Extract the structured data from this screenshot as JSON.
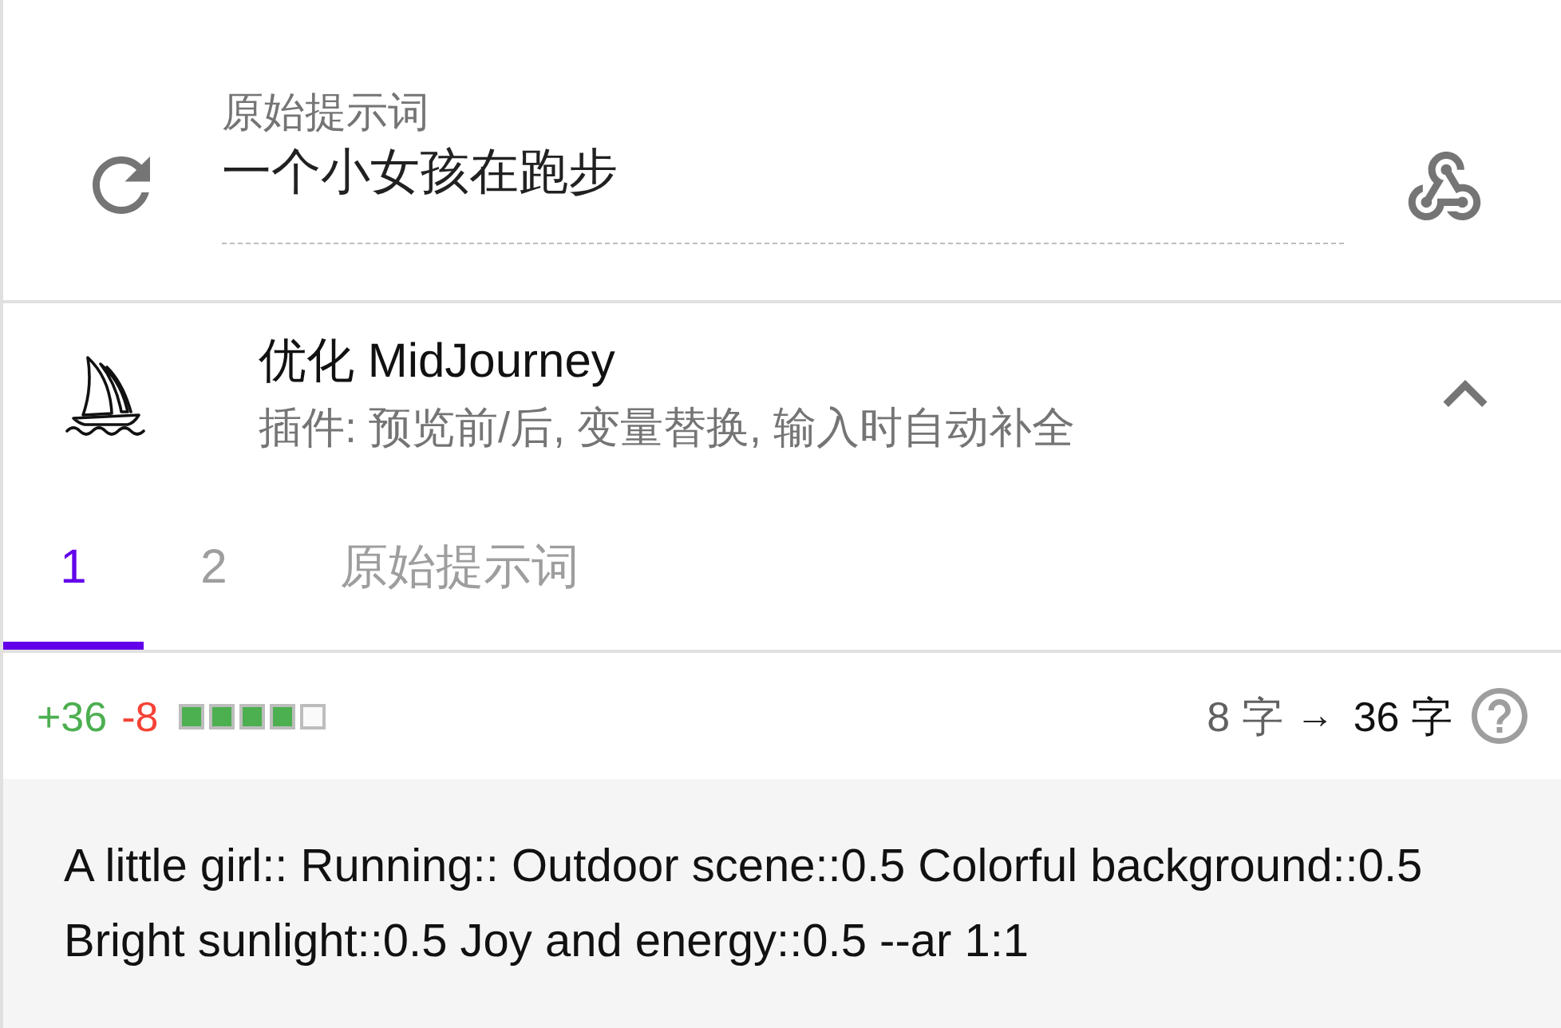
{
  "prompt_field": {
    "label": "原始提示词",
    "value": "一个小女孩在跑步"
  },
  "optimizer": {
    "title": "优化 MidJourney",
    "subtitle": "插件: 预览前/后, 变量替换, 输入时自动补全",
    "expanded": true
  },
  "tabs": [
    {
      "label": "1",
      "selected": true
    },
    {
      "label": "2",
      "selected": false
    },
    {
      "label": "原始提示词",
      "selected": false
    }
  ],
  "stats": {
    "added": "+36",
    "removed": "-8",
    "quality": {
      "level": 0.8
    },
    "before": "8 字",
    "arrow": "→",
    "after": "36 字"
  },
  "result": {
    "text": "A little girl:: Running:: Outdoor scene::0.5 Colorful background::0.5 Bright sunlight::0.5 Joy and energy::0.5 --ar 1:1"
  }
}
